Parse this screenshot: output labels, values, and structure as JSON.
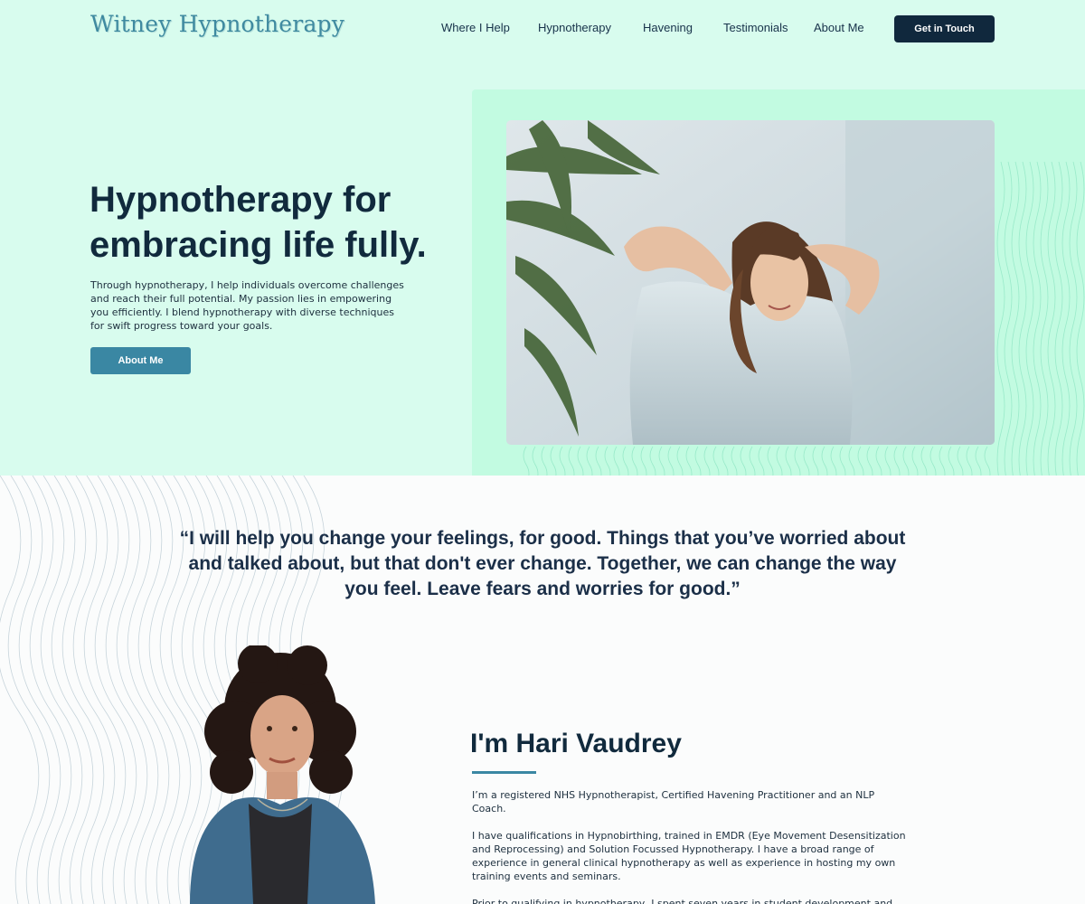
{
  "header": {
    "logo": "Witney Hypnotherapy",
    "nav": [
      "Where I Help",
      "Hypnotherapy",
      "Havening",
      "Testimonials",
      "About Me"
    ],
    "cta": "Get in Touch"
  },
  "hero": {
    "title": "Hypnotherapy for embracing life fully.",
    "text": "Through hypnotherapy, I help individuals overcome challenges and reach their full potential. My passion lies in empowering you efficiently. I blend hypnotherapy with diverse techniques for swift progress toward your goals.",
    "button": "About Me",
    "photo_icon": "relaxed-woman-photo"
  },
  "quote": "“I will help you change your feelings, for good. Things that you’ve worried about and talked about, but that don't ever change. Together, we can change the way you feel.  Leave fears and worries for good.”",
  "about": {
    "portrait_icon": "portrait-photo",
    "heading": "I'm Hari Vaudrey",
    "paragraphs": [
      "I’m a registered NHS Hypnotherapist, Certified Havening Practitioner and an NLP Coach.",
      "I have qualifications in Hypnobirthing, trained in EMDR (Eye Movement Desensitization and Reprocessing) and Solution Focussed Hypnotherapy.  I have a broad range of experience in general clinical hypnotherapy as well as experience in hosting my own training events and seminars.",
      "Prior to qualifying in hypnotherapy, I spent seven years in student development and mentoring at The Oxford Centre for Hindu Studies, Oxford University. Previous to this, I"
    ]
  },
  "colors": {
    "mint_bg": "#d8fcee",
    "panel_bg": "#c2fbe1",
    "navy": "#10283d",
    "teal_button": "#3a87a3"
  }
}
